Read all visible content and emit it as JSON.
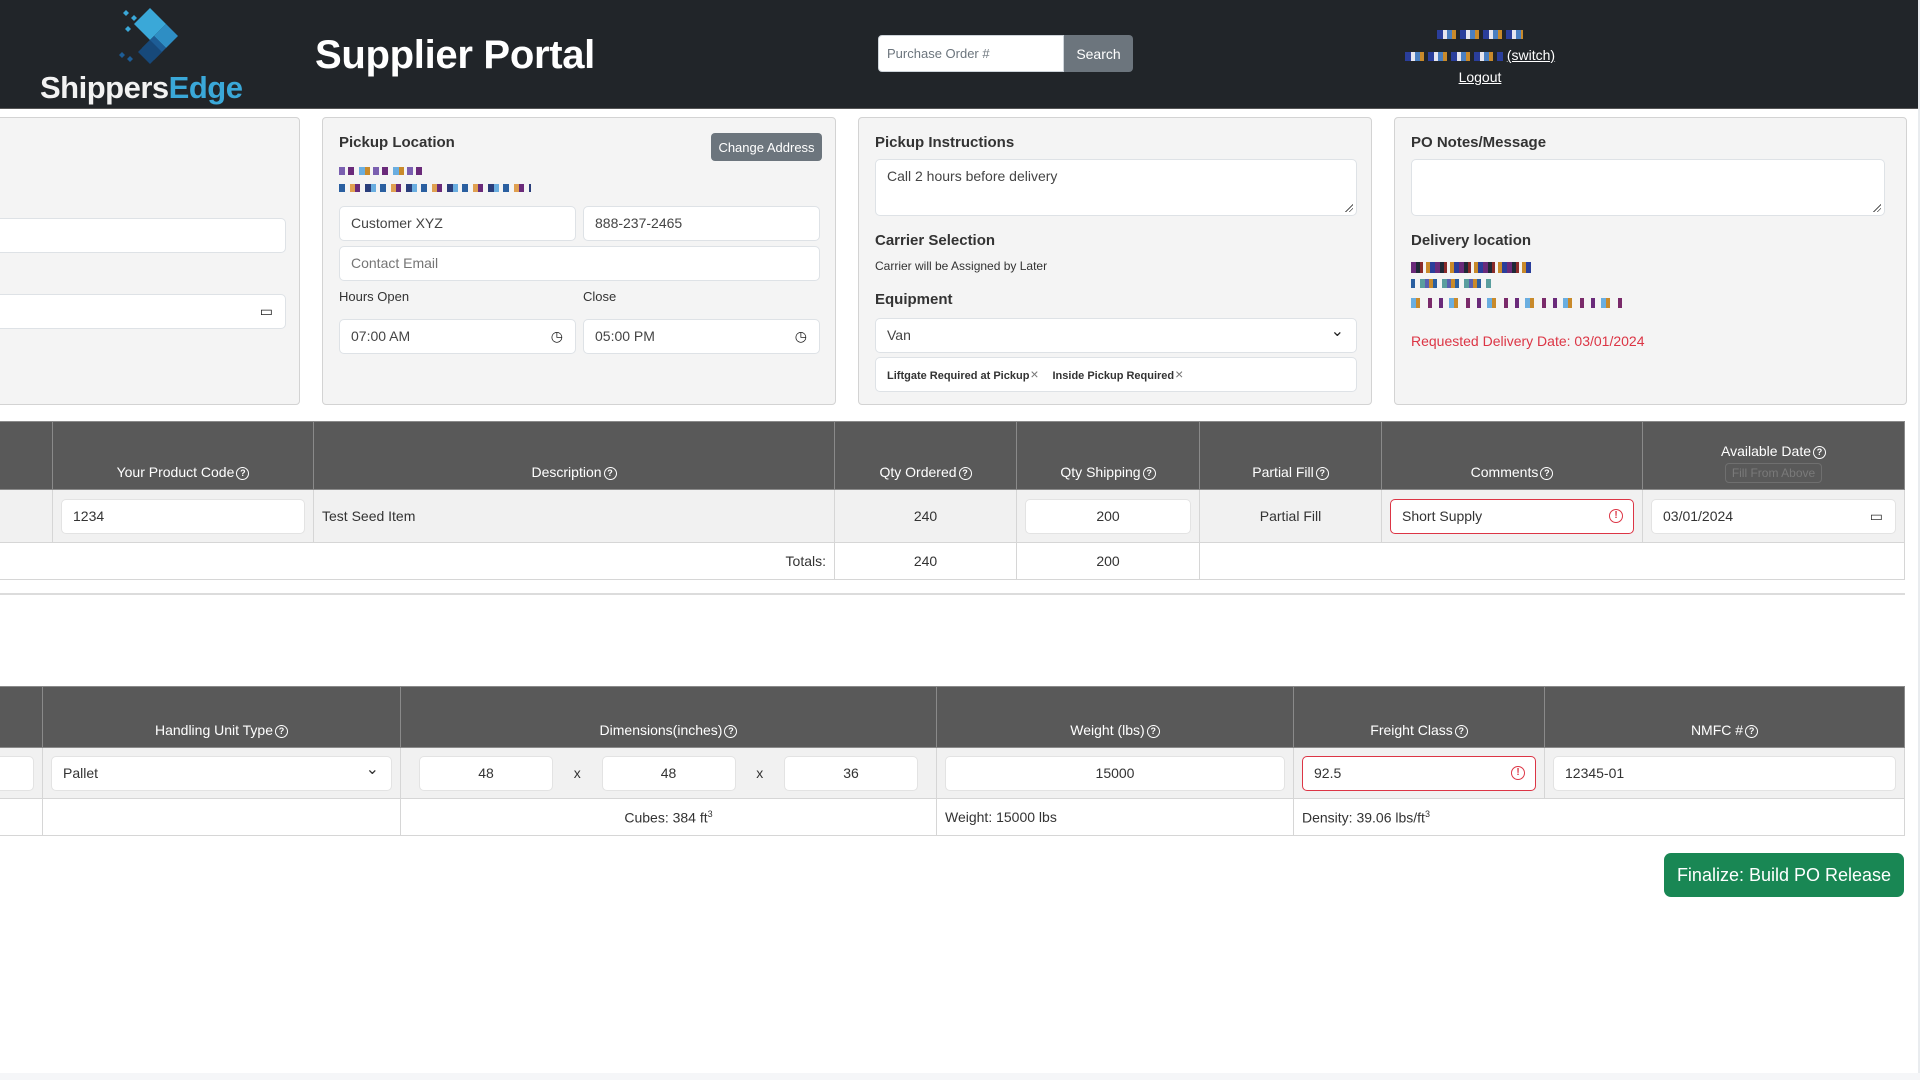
{
  "header": {
    "logo_text_a": "Shippers",
    "logo_text_b": "Edge",
    "app_title": "Supplier Portal",
    "search_placeholder": "Purchase Order #",
    "search_button": "Search",
    "switch_link": "(switch)",
    "logout_link": "Logout"
  },
  "colors": {
    "header_bg": "#212529",
    "brand_accent": "#3aa8d8",
    "primary_action": "#198754",
    "error": "#dc3545",
    "table_header": "#595959"
  },
  "pickup_location": {
    "title": "Pickup Location",
    "change_address_button": "Change Address",
    "company_name": "Customer XYZ",
    "phone": "888-237-2465",
    "email_placeholder": "Contact Email",
    "hours_open_label": "Hours Open",
    "hours_open_value": "07:00 AM",
    "close_label": "Close",
    "close_value": "05:00 PM"
  },
  "pickup_instructions": {
    "title": "Pickup Instructions",
    "value": "Call 2 hours before delivery",
    "carrier_title": "Carrier Selection",
    "carrier_text": "Carrier will be Assigned by Later",
    "equipment_title": "Equipment",
    "equipment_value": "Van",
    "accessorials": [
      "Liftgate Required at Pickup",
      "Inside Pickup Required"
    ],
    "remove_glyph": "×"
  },
  "po_notes": {
    "title": "PO Notes/Message",
    "value": "",
    "delivery_title": "Delivery location",
    "requested_delivery": "Requested Delivery Date: 03/01/2024"
  },
  "items_table": {
    "headers": {
      "product_code": "Your Product Code",
      "description": "Description",
      "qty_ordered": "Qty Ordered",
      "qty_shipping": "Qty Shipping",
      "partial_fill": "Partial Fill",
      "comments": "Comments",
      "available_date": "Available Date",
      "fill_from_above": "Fill From Above"
    },
    "rows": [
      {
        "product_code": "1234",
        "description": "Test Seed Item",
        "qty_ordered": "240",
        "qty_shipping": "200",
        "partial_fill": "Partial Fill",
        "comments": "Short Supply",
        "available_date": "03/01/2024"
      }
    ],
    "totals": {
      "label": "Totals:",
      "qty_ordered": "240",
      "qty_shipping": "200"
    }
  },
  "handling_table": {
    "headers": {
      "handling_unit_type": "Handling Unit Type",
      "dimensions": "Dimensions(inches)",
      "weight": "Weight (lbs)",
      "freight_class": "Freight Class",
      "nmfc": "NMFC #"
    },
    "rows": [
      {
        "handling_unit_type": "Pallet",
        "length": "48",
        "width": "48",
        "height": "36",
        "weight": "15000",
        "freight_class": "92.5",
        "nmfc": "12345-01"
      }
    ],
    "dimension_separator": "x",
    "summary": {
      "cubes": "Cubes: 384 ft",
      "weight": "Weight: 15000 lbs",
      "density": "Density: 39.06 lbs/ft",
      "cube_exponent": "3"
    }
  },
  "actions": {
    "finalize": "Finalize: Build PO Release"
  },
  "icons": {
    "help": "?",
    "warning": "!",
    "clock": "◷",
    "calendar": "▭",
    "chevron": "⌄"
  }
}
